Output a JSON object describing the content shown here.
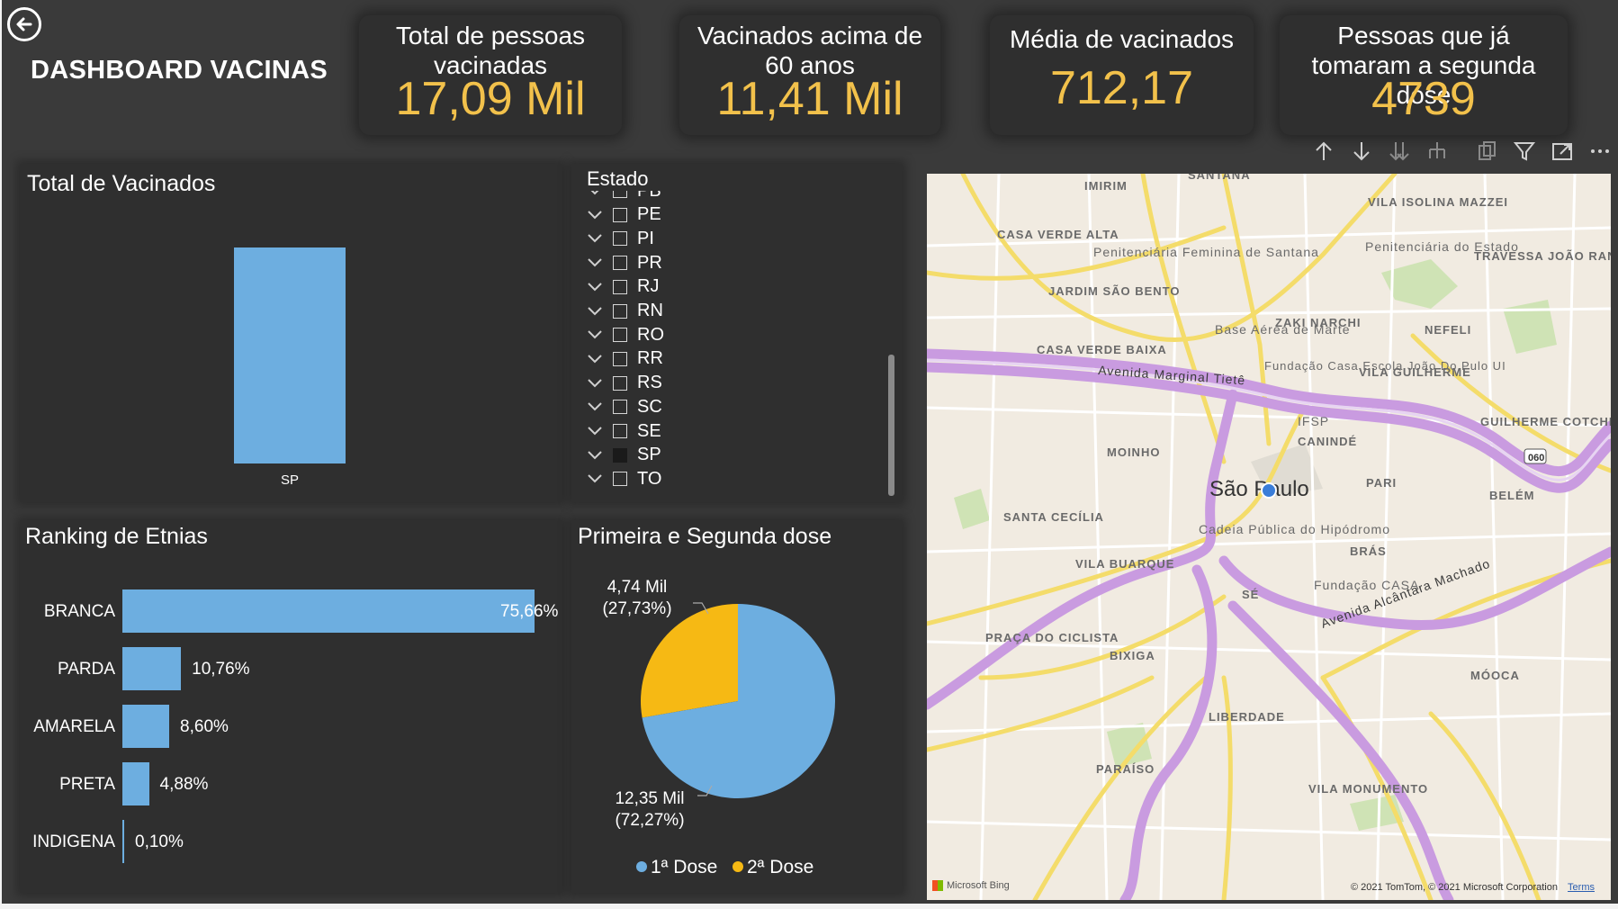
{
  "header": {
    "title": "DASHBOARD VACINAS"
  },
  "cards": [
    {
      "title": "Total de pessoas vacinadas",
      "value": "17,09 Mil"
    },
    {
      "title": "Vacinados acima de 60 anos",
      "value": "11,41 Mil"
    },
    {
      "title": "Média de vacinados",
      "value": "712,17"
    },
    {
      "title": "Pessoas que já tomaram a segunda dose",
      "value": "4739"
    }
  ],
  "total_vacinados": {
    "title": "Total de Vacinados",
    "chart_data": {
      "type": "bar",
      "categories": [
        "SP"
      ],
      "values": [
        17090
      ],
      "title": "Total de Vacinados"
    }
  },
  "estado": {
    "title": "Estado",
    "items": [
      {
        "label": "PB",
        "checked": false
      },
      {
        "label": "PE",
        "checked": false
      },
      {
        "label": "PI",
        "checked": false
      },
      {
        "label": "PR",
        "checked": false
      },
      {
        "label": "RJ",
        "checked": false
      },
      {
        "label": "RN",
        "checked": false
      },
      {
        "label": "RO",
        "checked": false
      },
      {
        "label": "RR",
        "checked": false
      },
      {
        "label": "RS",
        "checked": false
      },
      {
        "label": "SC",
        "checked": false
      },
      {
        "label": "SE",
        "checked": false
      },
      {
        "label": "SP",
        "checked": true
      },
      {
        "label": "TO",
        "checked": false
      }
    ]
  },
  "ranking": {
    "title": "Ranking de Etnias",
    "chart_data": {
      "type": "bar",
      "categories": [
        "BRANCA",
        "PARDA",
        "AMARELA",
        "PRETA",
        "INDIGENA"
      ],
      "values": [
        75.66,
        10.76,
        8.6,
        4.88,
        0.1
      ],
      "labels": [
        "75,66%",
        "10,76%",
        "8,60%",
        "4,88%",
        "0,10%"
      ]
    }
  },
  "doses": {
    "title": "Primeira e Segunda dose",
    "chart_data": {
      "type": "pie",
      "slices": [
        {
          "name": "1ª Dose",
          "value": 12350,
          "label_value": "12,35 Mil",
          "label_pct": "(72,27%)",
          "color": "#6daee0"
        },
        {
          "name": "2ª Dose",
          "value": 4740,
          "label_value": "4,74 Mil",
          "label_pct": "(27,73%)",
          "color": "#f6b914"
        }
      ]
    }
  },
  "map": {
    "labels": [
      "IMIRIM",
      "SANTANA",
      "VILA ISOLINA MAZZEI",
      "CASA VERDE ALTA",
      "Penitenciária Feminina de Santana",
      "Penitenciária do Estado",
      "TRAVESSA JOÃO RANGEL",
      "JARDIM SÃO BENTO",
      "Base Aérea de Marte",
      "ZAKI NARCHI",
      "NEFELI",
      "CASA VERDE BAIXA",
      "Avenida Marginal Tietê",
      "Fundação Casa Escola João Do Pulo UI",
      "VILA GUILHERME",
      "IFSP",
      "CANINDÉ",
      "GUILHERME COTCHING",
      "MOINHO",
      "PARI",
      "São Paulo",
      "BELÉM",
      "SANTA CECÍLIA",
      "Cadeia Pública do Hipódromo",
      "BRÁS",
      "VILA BUARQUE",
      "SÉ",
      "Fundação CASA",
      "Avenida Alcântara Machado",
      "PRAÇA DO CICLISTA",
      "BIXIGA",
      "MÓOCA",
      "LIBERDADE",
      "PARAÍSO",
      "VILA MONUMENTO",
      "060"
    ],
    "attribution": "© 2021 TomTom, © 2021 Microsoft Corporation",
    "terms": "Terms",
    "provider": "Microsoft Bing"
  }
}
